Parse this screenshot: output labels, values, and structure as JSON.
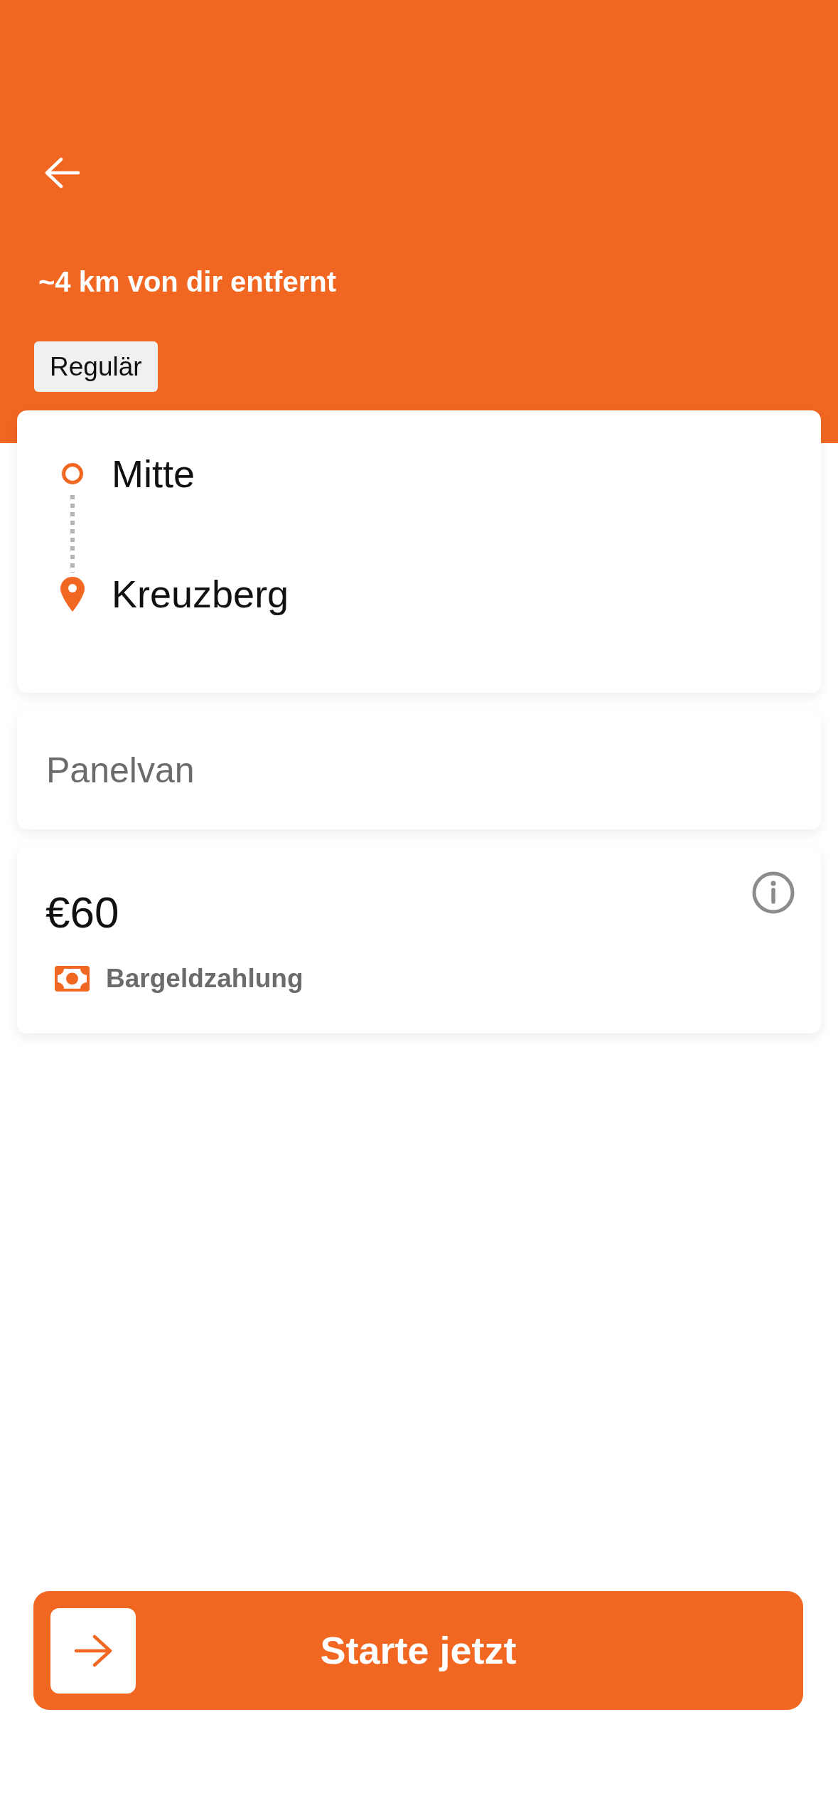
{
  "header": {
    "distance": "~4 km von dir entfernt",
    "tag": "Regulär"
  },
  "route": {
    "stops": [
      {
        "kind": "origin",
        "name": "Mitte"
      },
      {
        "kind": "destination",
        "name": "Kreuzberg"
      }
    ]
  },
  "vehicle": {
    "type": "Panelvan"
  },
  "price": {
    "amount": "€60",
    "payment_method": "Bargeldzahlung"
  },
  "start_button": {
    "label": "Starte jetzt"
  }
}
